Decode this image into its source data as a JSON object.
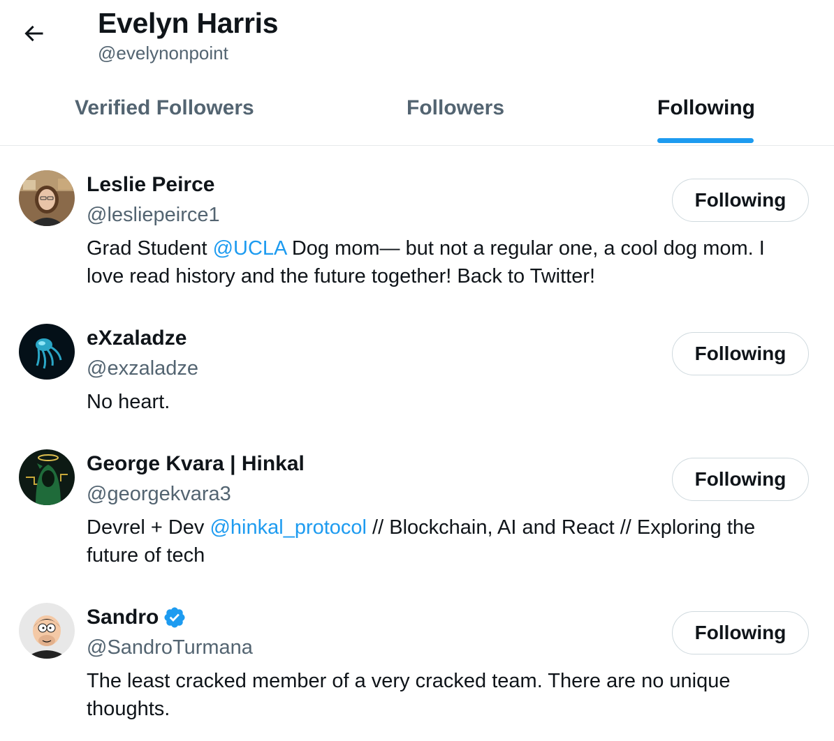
{
  "header": {
    "back_icon": "arrow-left-icon",
    "name": "Evelyn Harris",
    "handle": "@evelynonpoint"
  },
  "tabs": [
    {
      "label": "Verified Followers",
      "active": false
    },
    {
      "label": "Followers",
      "active": false
    },
    {
      "label": "Following",
      "active": true
    }
  ],
  "colors": {
    "accent": "#1d9bf0",
    "text_primary": "#0f1419",
    "text_secondary": "#536471",
    "border": "#cfd9de"
  },
  "users": [
    {
      "name": "Leslie Peirce",
      "handle": "@lesliepeirce1",
      "verified": false,
      "button_label": "Following",
      "bio_before": "Grad Student ",
      "bio_mention": "@UCLA",
      "bio_after": " Dog mom— but not a regular one, a cool dog mom. I love read history and the future together! Back to Twitter!"
    },
    {
      "name": "eXzaladze",
      "handle": "@exzaladze",
      "verified": false,
      "button_label": "Following",
      "bio_before": "No heart.",
      "bio_mention": "",
      "bio_after": ""
    },
    {
      "name": "George Kvara | Hinkal",
      "handle": "@georgekvara3",
      "verified": false,
      "button_label": "Following",
      "bio_before": "Devrel + Dev ",
      "bio_mention": "@hinkal_protocol",
      "bio_after": " // Blockchain, AI and React // Exploring the future of tech"
    },
    {
      "name": "Sandro",
      "handle": "@SandroTurmana",
      "verified": true,
      "button_label": "Following",
      "bio_before": "The least cracked member of a very cracked team. There are no unique thoughts.",
      "bio_mention": "",
      "bio_after": ""
    }
  ]
}
